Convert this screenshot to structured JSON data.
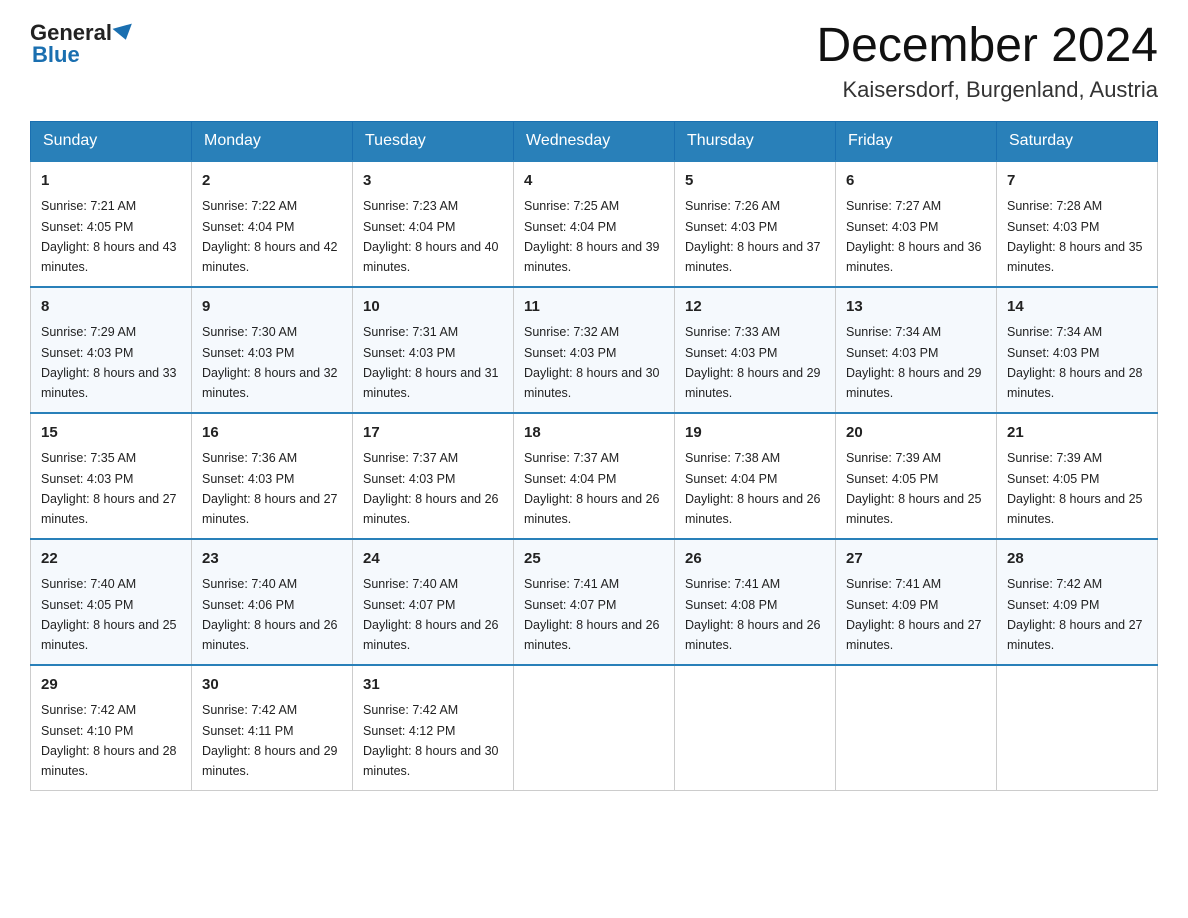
{
  "header": {
    "logo_general": "General",
    "logo_blue": "Blue",
    "month_title": "December 2024",
    "location": "Kaisersdorf, Burgenland, Austria"
  },
  "days_of_week": [
    "Sunday",
    "Monday",
    "Tuesday",
    "Wednesday",
    "Thursday",
    "Friday",
    "Saturday"
  ],
  "weeks": [
    [
      {
        "day": "1",
        "sunrise": "7:21 AM",
        "sunset": "4:05 PM",
        "daylight": "8 hours and 43 minutes."
      },
      {
        "day": "2",
        "sunrise": "7:22 AM",
        "sunset": "4:04 PM",
        "daylight": "8 hours and 42 minutes."
      },
      {
        "day": "3",
        "sunrise": "7:23 AM",
        "sunset": "4:04 PM",
        "daylight": "8 hours and 40 minutes."
      },
      {
        "day": "4",
        "sunrise": "7:25 AM",
        "sunset": "4:04 PM",
        "daylight": "8 hours and 39 minutes."
      },
      {
        "day": "5",
        "sunrise": "7:26 AM",
        "sunset": "4:03 PM",
        "daylight": "8 hours and 37 minutes."
      },
      {
        "day": "6",
        "sunrise": "7:27 AM",
        "sunset": "4:03 PM",
        "daylight": "8 hours and 36 minutes."
      },
      {
        "day": "7",
        "sunrise": "7:28 AM",
        "sunset": "4:03 PM",
        "daylight": "8 hours and 35 minutes."
      }
    ],
    [
      {
        "day": "8",
        "sunrise": "7:29 AM",
        "sunset": "4:03 PM",
        "daylight": "8 hours and 33 minutes."
      },
      {
        "day": "9",
        "sunrise": "7:30 AM",
        "sunset": "4:03 PM",
        "daylight": "8 hours and 32 minutes."
      },
      {
        "day": "10",
        "sunrise": "7:31 AM",
        "sunset": "4:03 PM",
        "daylight": "8 hours and 31 minutes."
      },
      {
        "day": "11",
        "sunrise": "7:32 AM",
        "sunset": "4:03 PM",
        "daylight": "8 hours and 30 minutes."
      },
      {
        "day": "12",
        "sunrise": "7:33 AM",
        "sunset": "4:03 PM",
        "daylight": "8 hours and 29 minutes."
      },
      {
        "day": "13",
        "sunrise": "7:34 AM",
        "sunset": "4:03 PM",
        "daylight": "8 hours and 29 minutes."
      },
      {
        "day": "14",
        "sunrise": "7:34 AM",
        "sunset": "4:03 PM",
        "daylight": "8 hours and 28 minutes."
      }
    ],
    [
      {
        "day": "15",
        "sunrise": "7:35 AM",
        "sunset": "4:03 PM",
        "daylight": "8 hours and 27 minutes."
      },
      {
        "day": "16",
        "sunrise": "7:36 AM",
        "sunset": "4:03 PM",
        "daylight": "8 hours and 27 minutes."
      },
      {
        "day": "17",
        "sunrise": "7:37 AM",
        "sunset": "4:03 PM",
        "daylight": "8 hours and 26 minutes."
      },
      {
        "day": "18",
        "sunrise": "7:37 AM",
        "sunset": "4:04 PM",
        "daylight": "8 hours and 26 minutes."
      },
      {
        "day": "19",
        "sunrise": "7:38 AM",
        "sunset": "4:04 PM",
        "daylight": "8 hours and 26 minutes."
      },
      {
        "day": "20",
        "sunrise": "7:39 AM",
        "sunset": "4:05 PM",
        "daylight": "8 hours and 25 minutes."
      },
      {
        "day": "21",
        "sunrise": "7:39 AM",
        "sunset": "4:05 PM",
        "daylight": "8 hours and 25 minutes."
      }
    ],
    [
      {
        "day": "22",
        "sunrise": "7:40 AM",
        "sunset": "4:05 PM",
        "daylight": "8 hours and 25 minutes."
      },
      {
        "day": "23",
        "sunrise": "7:40 AM",
        "sunset": "4:06 PM",
        "daylight": "8 hours and 26 minutes."
      },
      {
        "day": "24",
        "sunrise": "7:40 AM",
        "sunset": "4:07 PM",
        "daylight": "8 hours and 26 minutes."
      },
      {
        "day": "25",
        "sunrise": "7:41 AM",
        "sunset": "4:07 PM",
        "daylight": "8 hours and 26 minutes."
      },
      {
        "day": "26",
        "sunrise": "7:41 AM",
        "sunset": "4:08 PM",
        "daylight": "8 hours and 26 minutes."
      },
      {
        "day": "27",
        "sunrise": "7:41 AM",
        "sunset": "4:09 PM",
        "daylight": "8 hours and 27 minutes."
      },
      {
        "day": "28",
        "sunrise": "7:42 AM",
        "sunset": "4:09 PM",
        "daylight": "8 hours and 27 minutes."
      }
    ],
    [
      {
        "day": "29",
        "sunrise": "7:42 AM",
        "sunset": "4:10 PM",
        "daylight": "8 hours and 28 minutes."
      },
      {
        "day": "30",
        "sunrise": "7:42 AM",
        "sunset": "4:11 PM",
        "daylight": "8 hours and 29 minutes."
      },
      {
        "day": "31",
        "sunrise": "7:42 AM",
        "sunset": "4:12 PM",
        "daylight": "8 hours and 30 minutes."
      },
      null,
      null,
      null,
      null
    ]
  ]
}
